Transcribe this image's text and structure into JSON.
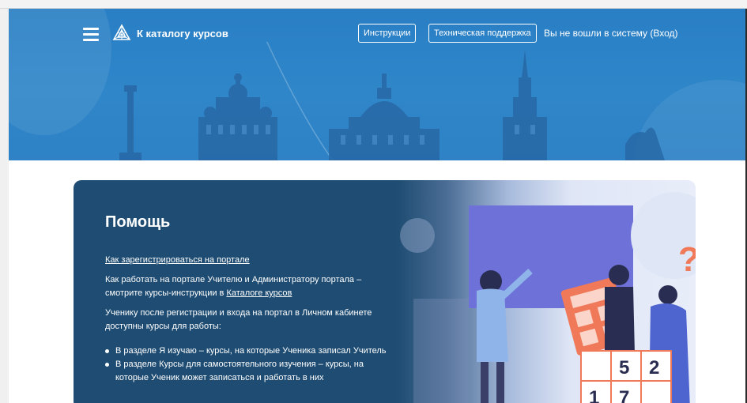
{
  "header": {
    "logo_text": "К каталогу курсов",
    "instructions_button": "Инструкции",
    "support_button": "Техническая поддержка",
    "login_status": "Вы не вошли в систему (Вход)"
  },
  "help": {
    "title": "Помощь",
    "register_link": "Как зарегистрироваться на портале",
    "teachers_text": "Как работать на портале Учителю и Администратору портала – смотрите курсы-инструкции в",
    "catalog_link": "Каталоге курсов",
    "students_text": "Ученику после регистрации и входа на портал в Личном кабинете доступны курсы для работы:",
    "bullets": [
      "В разделе Я изучаю – курсы, на которые Ученика записал Учитель",
      "В разделе Курсы для самостоятельного изучения – курсы, на которые Ученик может записаться и работать в них"
    ]
  },
  "illustration": {
    "grid_numbers": [
      "5",
      "2",
      "1",
      "7"
    ],
    "question_mark": "?"
  },
  "colors": {
    "header_blue": "#2e82c5",
    "card_dark": "#1e4c72",
    "accent_orange": "#f0795a"
  }
}
